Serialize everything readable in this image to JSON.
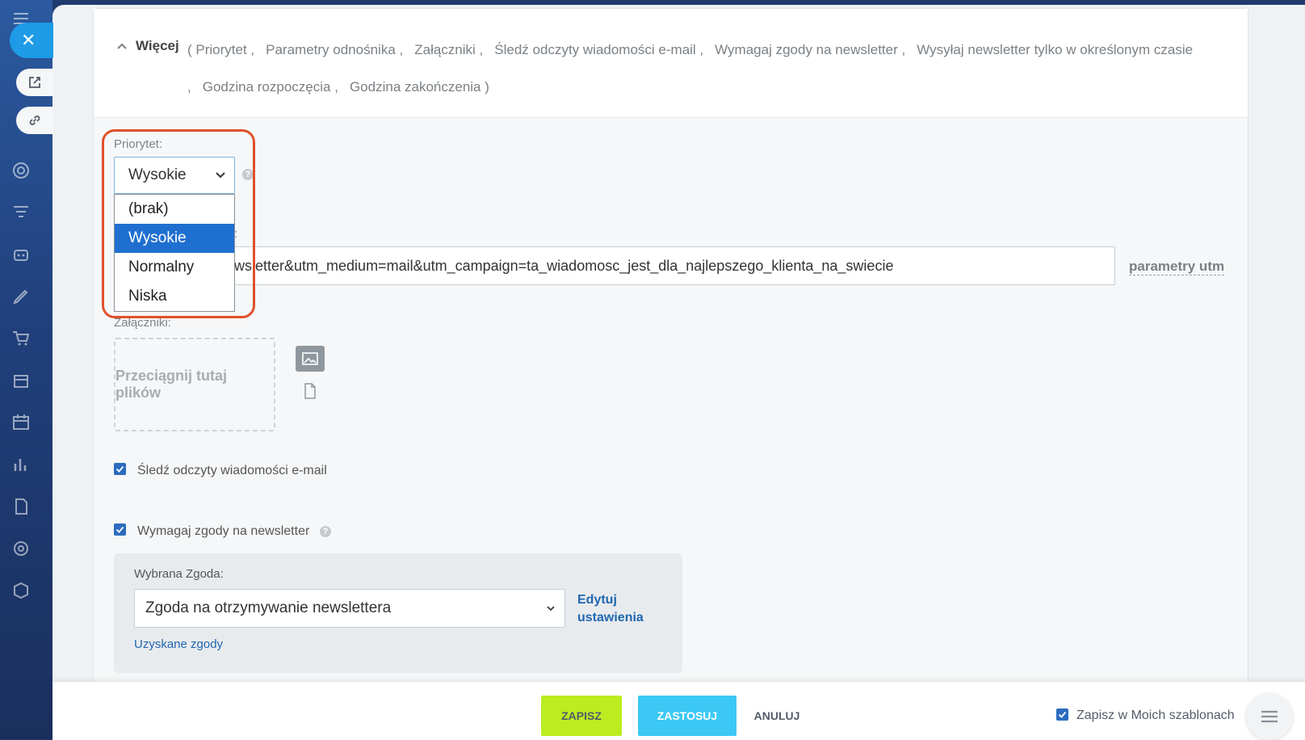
{
  "sidebar": {
    "close_symbol": "✕",
    "icons": [
      "menu-icon",
      "target-icon",
      "filter-icon",
      "robot-icon",
      "pen-icon",
      "cart-icon",
      "store-icon",
      "calendar-icon",
      "chart-icon",
      "document-icon",
      "settings-icon",
      "box-icon"
    ],
    "open_link_icon": "external-link-icon",
    "copy_link_icon": "link-icon"
  },
  "more": {
    "title": "Więcej",
    "links": [
      "Priorytet",
      "Parametry odnośnika",
      "Załączniki",
      "Śledź odczyty wiadomości e-mail",
      "Wymagaj zgody na newsletter",
      "Wysyłaj newsletter tylko w określonym czasie",
      "Godzina rozpoczęcia",
      "Godzina zakończenia"
    ]
  },
  "priority": {
    "label": "Priorytet:",
    "selected": "Wysokie",
    "options": [
      "(brak)",
      "Wysokie",
      "Normalny",
      "Niska"
    ]
  },
  "url": {
    "label_suffix": ":",
    "value": "wsletter&utm_medium=mail&utm_campaign=ta_wiadomosc_jest_dla_najlepszego_klienta_na_swiecie",
    "utm_link": "parametry utm"
  },
  "attachments": {
    "label": "Załączniki:",
    "dropzone": "Przeciągnij tutaj plików"
  },
  "track_reads": {
    "label": "Śledź odczyty wiadomości e-mail",
    "checked": true
  },
  "require_consent": {
    "label": "Wymagaj zgody na newsletter",
    "checked": true
  },
  "consent": {
    "label": "Wybrana Zgoda:",
    "selected": "Zgoda na otrzymywanie newslettera",
    "edit_link_line1": "Edytuj",
    "edit_link_line2": "ustawienia",
    "obtained_link": "Uzyskane zgody"
  },
  "footer": {
    "save": "ZAPISZ",
    "apply": "ZASTOSUJ",
    "cancel": "ANULUJ",
    "save_template": "Zapisz w Moich szablonach",
    "save_template_checked": true
  },
  "colors": {
    "accent_blue": "#2b6cbf",
    "highlight": "#e0502a",
    "save_green": "#bbed21",
    "apply_cyan": "#3bc8f5",
    "selected_option": "#1f6fd0"
  }
}
